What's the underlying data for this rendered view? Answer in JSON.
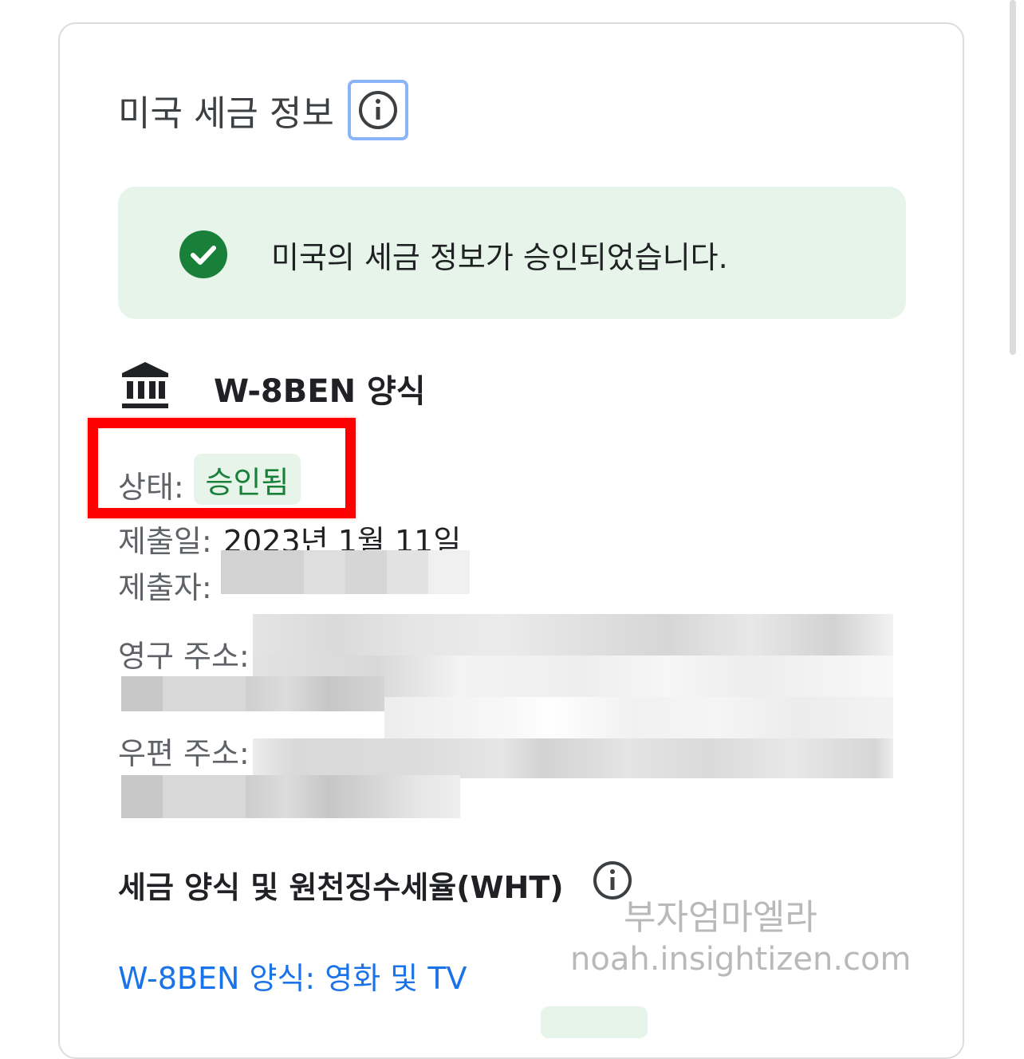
{
  "section": {
    "title": "미국 세금 정보",
    "info_icon": "info-icon"
  },
  "banner": {
    "icon": "check-circle-icon",
    "message": "미국의 세금 정보가 승인되었습니다.",
    "bg_color": "#e6f4ea",
    "icon_color": "#188038"
  },
  "form": {
    "icon": "bank-icon",
    "title": "W-8BEN 양식",
    "status_label": "상태:",
    "status_value": "승인됨",
    "submitted_label": "제출일:",
    "submitted_value": "2023년 1월 11일",
    "submitter_label": "제출자:",
    "permanent_address_label": "영구 주소:",
    "mailing_address_label": "우편 주소:"
  },
  "wht": {
    "title": "세금 양식 및 원천징수세율(WHT)",
    "info_icon": "info-icon",
    "link": "W-8BEN 양식: 영화 및 TV"
  },
  "watermark": {
    "line1": "부자엄마엘라",
    "line2": "noah.insightizen.com"
  },
  "colors": {
    "highlight": "#ff0000",
    "link": "#1a73e8",
    "status_green": "#188038",
    "focus_ring": "#8ab4f8"
  }
}
